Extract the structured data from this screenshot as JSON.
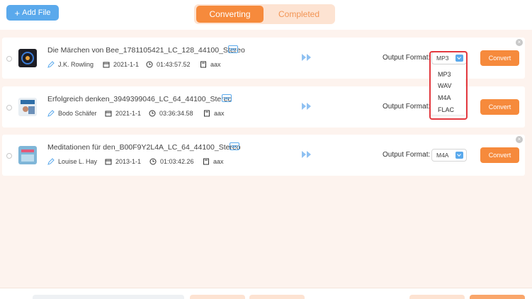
{
  "header": {
    "add_file_label": "Add File",
    "tabs": [
      {
        "label": "Converting",
        "active": true
      },
      {
        "label": "Completed",
        "active": false
      }
    ]
  },
  "items": [
    {
      "title": "Die Märchen von Bee_1781105421_LC_128_44100_Stereo",
      "author": "J.K. Rowling",
      "date": "2021-1-1",
      "duration": "01:43:57.52",
      "format": "aax",
      "output_format_label": "Output Format:",
      "output_format_value": "MP3",
      "convert_label": "Convert"
    },
    {
      "title": "Erfolgreich denken_3949399046_LC_64_44100_Stereo",
      "author": "Bodo Schäfer",
      "date": "2021-1-1",
      "duration": "03:36:34.58",
      "format": "aax",
      "output_format_label": "Output Format:",
      "output_format_value": "",
      "convert_label": "Convert"
    },
    {
      "title": "Meditationen für den_B00F9Y2L4A_LC_64_44100_Stereo",
      "author": "Louise L. Hay",
      "date": "2013-1-1",
      "duration": "01:03:42.26",
      "format": "aax",
      "output_format_label": "Output Format:",
      "output_format_value": "M4A",
      "convert_label": "Convert"
    }
  ],
  "dropdown": {
    "options": [
      "MP3",
      "WAV",
      "M4A",
      "FLAC"
    ]
  },
  "colors": {
    "accent": "#f68a3c",
    "primary_blue": "#5aa9ec",
    "highlight": "#e3393f",
    "background": "#fdf3ee"
  },
  "icons": {
    "author": "pen-icon",
    "date": "calendar-icon",
    "duration": "clock-icon",
    "format": "file-icon",
    "arrow": "double-chevron-right-icon"
  }
}
